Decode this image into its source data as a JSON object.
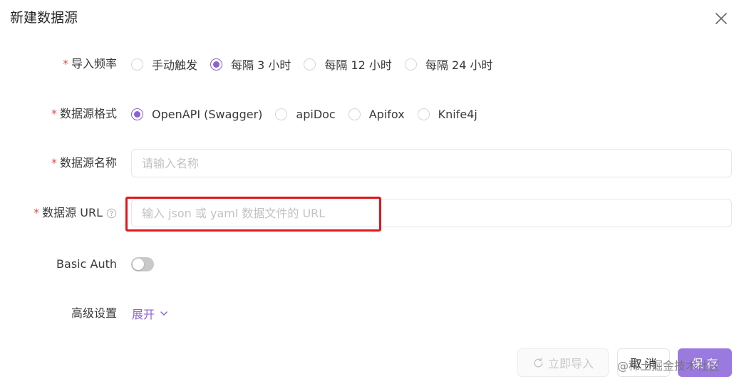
{
  "dialog": {
    "title": "新建数据源"
  },
  "form": {
    "frequency": {
      "label": "导入频率",
      "options": [
        "手动触发",
        "每隔 3 小时",
        "每隔 12 小时",
        "每隔 24 小时"
      ],
      "selected": "每隔 3 小时"
    },
    "format": {
      "label": "数据源格式",
      "options": [
        "OpenAPI (Swagger)",
        "apiDoc",
        "Apifox",
        "Knife4j"
      ],
      "selected": "OpenAPI (Swagger)"
    },
    "name": {
      "label": "数据源名称",
      "placeholder": "请输入名称",
      "value": ""
    },
    "url": {
      "label": "数据源 URL",
      "placeholder": "输入 json 或 yaml 数据文件的 URL",
      "value": ""
    },
    "basic_auth": {
      "label": "Basic Auth",
      "enabled": false
    },
    "advanced": {
      "label": "高级设置",
      "expand_label": "展开"
    }
  },
  "footer": {
    "import_label": "立即导入",
    "cancel_label": "取 消",
    "save_label": "保 存"
  },
  "watermark": "@稀土掘金技术社区",
  "colors": {
    "accent": "#8a63d2",
    "required": "#e5484d",
    "highlight": "#e0181e",
    "save_bg": "#9b7ae0"
  }
}
